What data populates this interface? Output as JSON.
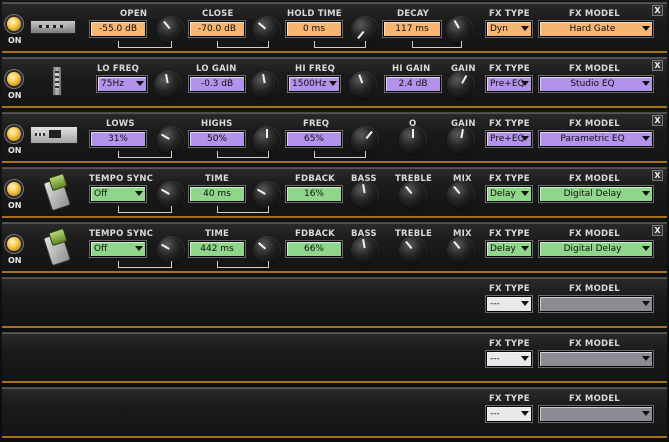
{
  "colors": {
    "orange": "#f6b570",
    "purple": "#b392ea",
    "green": "#8fd68a",
    "disabled": "#8b8b94",
    "rack_trim": "#a5711d"
  },
  "common": {
    "on_label": "ON",
    "close_label": "X",
    "fx_type_label": "FX TYPE",
    "fx_model_label": "FX MODEL",
    "power_icon": "power-led-icon"
  },
  "slots": [
    {
      "device_icon": "rack-gate-device-icon",
      "labels": {
        "open": "OPEN",
        "close": "CLOSE",
        "hold": "HOLD TIME",
        "decay": "DECAY"
      },
      "values": {
        "open": "-55.0 dB",
        "close": "-70.0 dB",
        "hold": "0 ms",
        "decay": "117 ms"
      },
      "fx_type": "Dyn",
      "fx_model": "Hard Gate"
    },
    {
      "device_icon": "slim-eq-device-icon",
      "labels": {
        "lo_freq": "LO FREQ",
        "lo_gain": "LO GAIN",
        "hi_freq": "HI FREQ",
        "hi_gain": "HI GAIN",
        "gain": "GAIN"
      },
      "values": {
        "lo_freq": "75Hz",
        "lo_gain": "-0.3 dB",
        "hi_freq": "1500Hz",
        "hi_gain": "2.4 dB"
      },
      "fx_type": "Pre+EQ",
      "fx_model": "Studio EQ"
    },
    {
      "device_icon": "rack-eq-unit-icon",
      "labels": {
        "lows": "LOWS",
        "highs": "HIGHS",
        "freq": "FREQ",
        "q": "Q",
        "gain": "GAIN"
      },
      "values": {
        "lows": "31%",
        "highs": "50%",
        "freq": "65%"
      },
      "fx_type": "Pre+EQ",
      "fx_model": "Parametric EQ"
    },
    {
      "device_icon": "delay-pedal-icon",
      "labels": {
        "tempo": "TEMPO SYNC",
        "time": "TIME",
        "fdback": "FDBACK",
        "bass": "BASS",
        "treble": "TREBLE",
        "mix": "MIX"
      },
      "values": {
        "tempo": "Off",
        "time": "40 ms",
        "fdback": "16%"
      },
      "fx_type": "Delay",
      "fx_model": "Digital Delay"
    },
    {
      "device_icon": "delay-pedal-icon",
      "labels": {
        "tempo": "TEMPO SYNC",
        "time": "TIME",
        "fdback": "FDBACK",
        "bass": "BASS",
        "treble": "TREBLE",
        "mix": "MIX"
      },
      "values": {
        "tempo": "Off",
        "time": "442 ms",
        "fdback": "66%"
      },
      "fx_type": "Delay",
      "fx_model": "Digital Delay"
    },
    {
      "fx_type": "---",
      "fx_model": ""
    },
    {
      "fx_type": "---",
      "fx_model": ""
    },
    {
      "fx_type": "---",
      "fx_model": ""
    }
  ]
}
